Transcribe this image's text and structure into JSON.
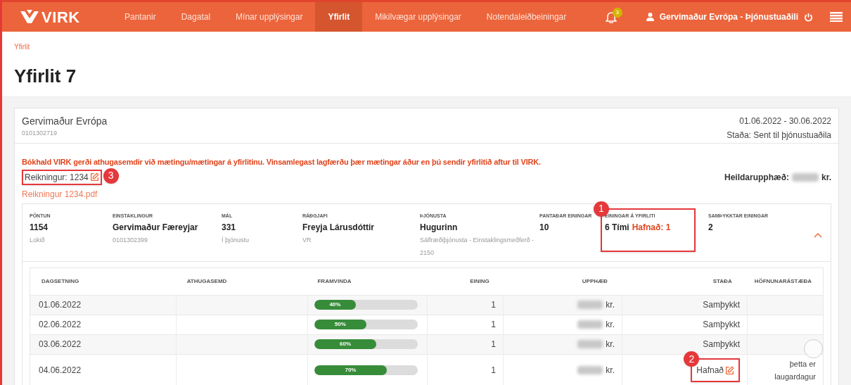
{
  "nav": {
    "logo": "VIRK",
    "items": [
      {
        "label": "Pantanir",
        "selected": false
      },
      {
        "label": "Dagatal",
        "selected": false
      },
      {
        "label": "Mínar upplýsingar",
        "selected": false
      },
      {
        "label": "Yfirlit",
        "selected": true
      },
      {
        "label": "Mikilvægar upplýsingar",
        "selected": false
      },
      {
        "label": "Notendaleiðbeiningar",
        "selected": false
      }
    ],
    "notification_count": "3",
    "user": "Gervimaður Evrópa - Þjónustuaðili"
  },
  "breadcrumb": "Yfirlit",
  "title": "Yfirlit 7",
  "card": {
    "name": "Gervimaður Evrópa",
    "id": "0101302719",
    "period": "01.06.2022 - 30.06.2022",
    "status": "Staða: Sent til þjónustuaðila",
    "warning": "Bókhald VIRK gerði athugasemdir við mætingu/mætingar á yfirlitinu. Vinsamlegast lagfærðu þær mætingar áður en þú sendir yfirlitið aftur til VIRK.",
    "invoice": {
      "label": "Reikningur: 1234",
      "annotation": "3"
    },
    "invoice_file": "Reikningur 1234.pdf",
    "total_label": "Heildarupphæð:",
    "total_unit": "kr.",
    "summary": [
      {
        "label": "PÖNTUN",
        "value": "1154",
        "sub": "Lokið"
      },
      {
        "label": "EINSTAKLINGUR",
        "value": "Gervimaður Færeyjar",
        "sub": "0101302399"
      },
      {
        "label": "MÁL",
        "value": "331",
        "sub": "Í þjónustu"
      },
      {
        "label": "RÁÐGJAFI",
        "value": "Freyja Lárusdóttir",
        "sub": "VR"
      },
      {
        "label": "ÞJÓNUSTA",
        "value": "Hugurinn",
        "sub": "Sálfræðiþjónusta - Einstaklingsmeðferð - 2150"
      },
      {
        "label": "PANTAÐAR EININGAR",
        "value": "10"
      },
      {
        "label": "EININGAR Á YFIRLITI",
        "value": "6 Tími",
        "extra": "Hafnað: 1",
        "annotation": "1"
      },
      {
        "label": "SAMÞYKKTAR EININGAR",
        "value": "2"
      }
    ],
    "expanded": true,
    "table": {
      "columns": [
        "DAGSETNING",
        "ATHUGASEMD",
        "FRAMVINDA",
        "EINING",
        "UPPHÆÐ",
        "STAÐA",
        "HÖFNUNARÁSTÆÐA"
      ],
      "rows": [
        {
          "date": "01.06.2022",
          "progress": {
            "level": 0.4,
            "label": "40%"
          },
          "unit": "1",
          "amount_unit": "kr.",
          "status": "Samþykkt",
          "editable": false
        },
        {
          "date": "02.06.2022",
          "progress": {
            "level": 0.5,
            "label": "50%"
          },
          "unit": "1",
          "amount_unit": "kr.",
          "status": "Samþykkt",
          "editable": false
        },
        {
          "date": "03.06.2022",
          "progress": {
            "level": 0.6,
            "label": "60%"
          },
          "unit": "1",
          "amount_unit": "kr.",
          "status": "Samþykkt",
          "editable": false
        },
        {
          "date": "04.06.2022",
          "progress": {
            "level": 0.7,
            "label": "70%"
          },
          "unit": "1",
          "amount_unit": "kr.",
          "status": "Hafnað",
          "editable": true,
          "reason": "þetta er laugardagur",
          "annotation": "2"
        }
      ]
    }
  }
}
